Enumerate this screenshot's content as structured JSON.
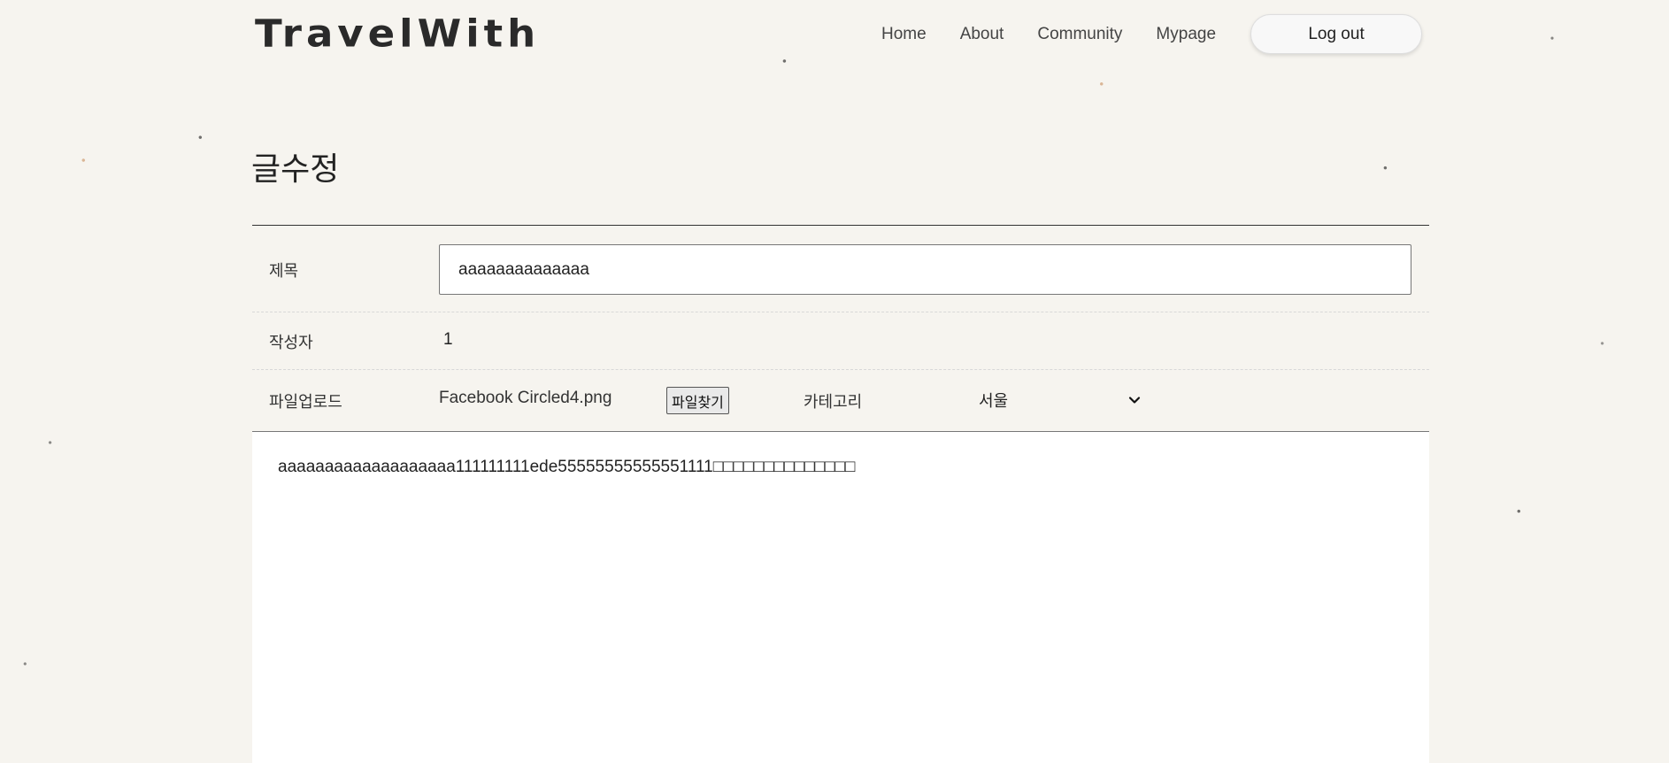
{
  "header": {
    "logo": "TravelWith",
    "nav": [
      "Home",
      "About",
      "Community",
      "Mypage"
    ],
    "logout_label": "Log out"
  },
  "page": {
    "title": "글수정"
  },
  "form": {
    "title_label": "제목",
    "title_value": "aaaaaaaaaaaaaa",
    "author_label": "작성자",
    "author_value": "1",
    "file_label": "파일업로드",
    "file_name": "Facebook Circled4.png",
    "file_button": "파일찾기",
    "category_label": "카테고리",
    "category_value": "서울",
    "content": "aaaaaaaaaaaaaaaaaaa111111111ede55555555555551111□□□□□□□□□□□□□□"
  }
}
